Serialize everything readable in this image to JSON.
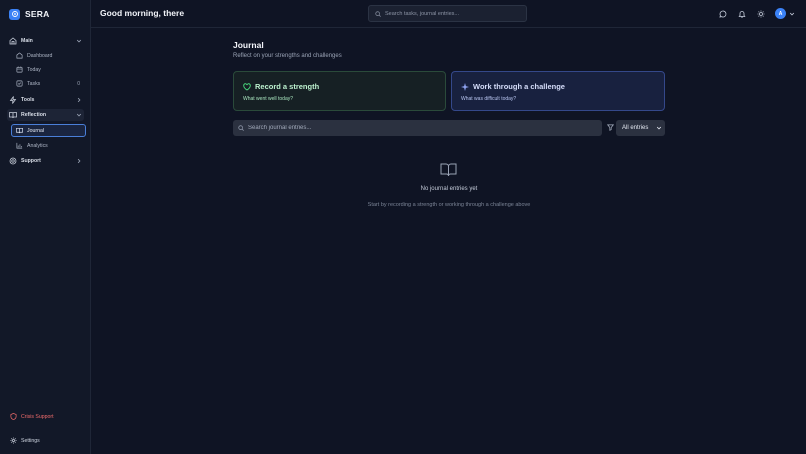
{
  "app": {
    "name": "SERA"
  },
  "colors": {
    "accent": "#3b82f6",
    "strength": "#22c55e",
    "challenge": "#6366f1",
    "crisis": "#ef6b6b"
  },
  "sidebar": {
    "groups": [
      {
        "label": "Main",
        "icon": "home-icon",
        "expanded": true
      },
      {
        "label": "Tools",
        "icon": "zap-icon",
        "expanded": false
      },
      {
        "label": "Reflection",
        "icon": "book-icon",
        "expanded": true
      },
      {
        "label": "Support",
        "icon": "life-buoy-icon",
        "expanded": false
      }
    ],
    "main_items": [
      {
        "label": "Dashboard",
        "icon": "home-icon"
      },
      {
        "label": "Today",
        "icon": "calendar-icon"
      },
      {
        "label": "Tasks",
        "icon": "check-square-icon",
        "count": "0"
      }
    ],
    "reflection_items": [
      {
        "label": "Journal",
        "icon": "book-open-icon"
      },
      {
        "label": "Analytics",
        "icon": "bar-chart-icon"
      }
    ],
    "crisis_label": "Crisis Support",
    "settings_label": "Settings"
  },
  "header": {
    "greeting": "Good morning, there",
    "search_placeholder": "Search tasks, journal entries...",
    "avatar_initial": "A"
  },
  "journal": {
    "title": "Journal",
    "subtitle": "Reflect on your strengths and challenges",
    "strength_card": {
      "title": "Record a strength",
      "subtitle": "What went well today?"
    },
    "challenge_card": {
      "title": "Work through a challenge",
      "subtitle": "What was difficult today?"
    },
    "search_placeholder": "Search journal entries...",
    "filter_selected": "All entries",
    "empty_title": "No journal entries yet",
    "empty_subtitle": "Start by recording a strength or working through a challenge above"
  }
}
